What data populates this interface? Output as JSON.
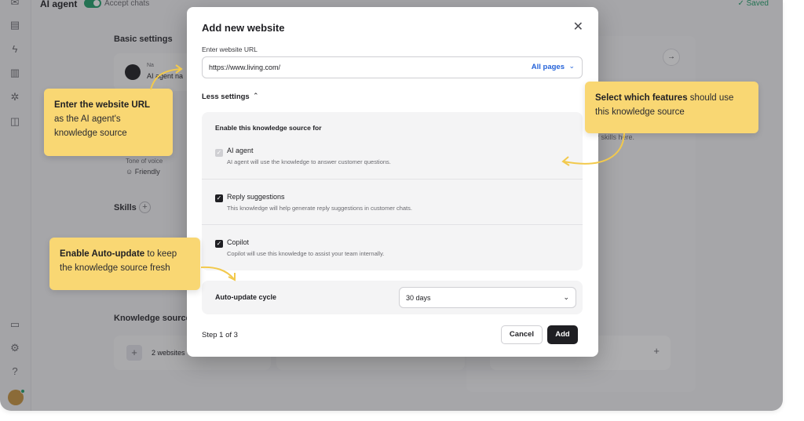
{
  "app": {
    "title": "AI agent",
    "accept_chats_label": "Accept chats",
    "saved_label": "Saved",
    "rail_icons": [
      "inbox-icon",
      "contacts-icon",
      "lightning-icon",
      "reports-icon",
      "sparkle-icon",
      "book-icon",
      "billing-icon",
      "settings-icon",
      "help-icon"
    ]
  },
  "background": {
    "basic_settings": "Basic settings",
    "name_hint": "Na",
    "name_value": "AI agent na",
    "tone_label": "Tone of voice",
    "tone_value": "Friendly",
    "skills_label": "Skills",
    "skills_hint": "r skills here.",
    "knowledge_sources_label": "Knowledge sources",
    "websites_label": "2 websites"
  },
  "modal": {
    "title": "Add new website",
    "url_label": "Enter website URL",
    "url_value": "https://www.living.com/",
    "scope_label": "All pages",
    "less_settings_label": "Less settings",
    "enable_heading": "Enable this knowledge source for",
    "options": [
      {
        "title": "AI agent",
        "description": "AI agent will use the knowledge to answer customer questions.",
        "checked": true,
        "disabled": true
      },
      {
        "title": "Reply suggestions",
        "description": "This knowledge will help generate reply suggestions in customer chats.",
        "checked": true,
        "disabled": false
      },
      {
        "title": "Copilot",
        "description": "Copilot will use this knowledge to assist your team internally.",
        "checked": true,
        "disabled": false
      }
    ],
    "cycle_label": "Auto-update cycle",
    "cycle_value": "30 days",
    "step_label": "Step 1 of 3",
    "cancel_label": "Cancel",
    "add_label": "Add"
  },
  "callouts": {
    "url": {
      "bold": "Enter the website URL",
      "rest1": "as the AI agent's",
      "rest2": "knowledge source"
    },
    "features": {
      "bold": "Select which features",
      "rest1": " should use",
      "rest2": "this knowledge source"
    },
    "autoupdate": {
      "bold": "Enable Auto-update",
      "rest1": " to keep",
      "rest2": "the knowledge source fresh"
    }
  },
  "colors": {
    "accent_green": "#22a06b",
    "link_blue": "#2563d9",
    "callout_yellow": "#f9d773",
    "primary_dark": "#1f1f23"
  }
}
